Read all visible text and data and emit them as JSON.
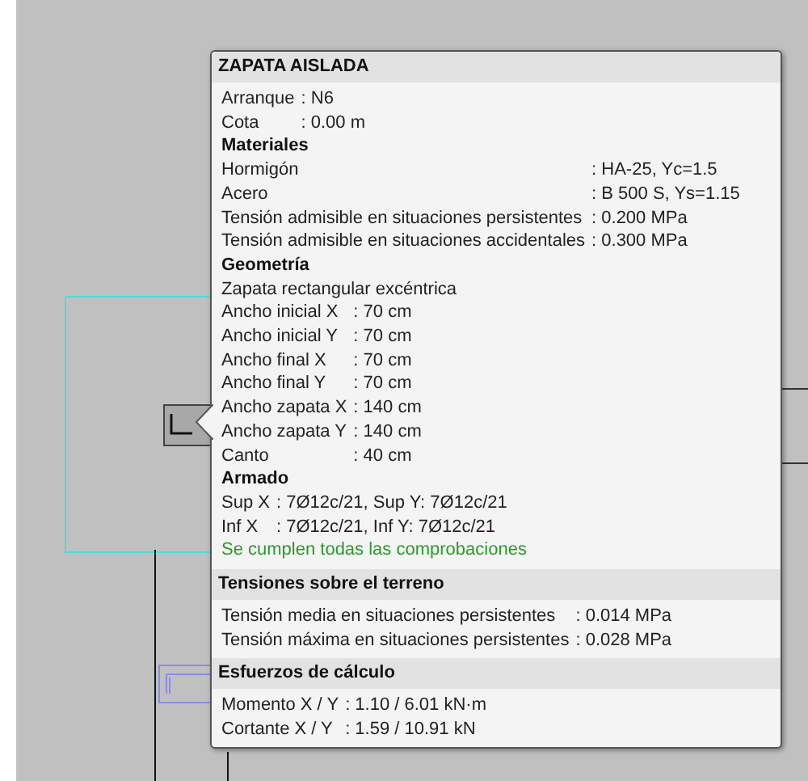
{
  "panel": {
    "sections": [
      {
        "title": "ZAPATA AISLADA",
        "blocks": [
          {
            "kind": "pairs",
            "rows": [
              {
                "label": "Arranque",
                "value": ": N6"
              },
              {
                "label": "Cota",
                "value": ": 0.00 m"
              }
            ]
          },
          {
            "kind": "heading",
            "text": "Materiales"
          },
          {
            "kind": "pairs",
            "rows": [
              {
                "label": "Hormigón",
                "value": ": HA-25, Yc=1.5"
              },
              {
                "label": "Acero",
                "value": ": B 500 S, Ys=1.15"
              },
              {
                "label": "Tensión admisible en situaciones persistentes",
                "value": ": 0.200 MPa"
              },
              {
                "label": "Tensión admisible en situaciones accidentales",
                "value": ": 0.300 MPa"
              }
            ]
          },
          {
            "kind": "heading",
            "text": "Geometría"
          },
          {
            "kind": "line",
            "text": "Zapata rectangular excéntrica"
          },
          {
            "kind": "pairs",
            "rows": [
              {
                "label": "Ancho inicial X",
                "value": ": 70 cm"
              },
              {
                "label": "Ancho inicial Y",
                "value": ": 70 cm"
              },
              {
                "label": "Ancho final X",
                "value": ": 70 cm"
              },
              {
                "label": "Ancho final Y",
                "value": ": 70 cm"
              },
              {
                "label": "Ancho zapata X",
                "value": ": 140 cm"
              },
              {
                "label": "Ancho zapata Y",
                "value": ": 140 cm"
              },
              {
                "label": "Canto",
                "value": ": 40 cm"
              }
            ]
          },
          {
            "kind": "heading",
            "text": "Armado"
          },
          {
            "kind": "pairs",
            "rows": [
              {
                "label": "Sup X",
                "value": ": 7Ø12c/21, Sup Y: 7Ø12c/21"
              },
              {
                "label": "Inf X",
                "value": ": 7Ø12c/21, Inf Y: 7Ø12c/21"
              }
            ]
          },
          {
            "kind": "status",
            "text": "Se cumplen todas las comprobaciones"
          }
        ]
      },
      {
        "title": "Tensiones sobre el terreno",
        "blocks": [
          {
            "kind": "pairs",
            "rows": [
              {
                "label": "Tensión media en situaciones persistentes",
                "value": ": 0.014 MPa"
              },
              {
                "label": "Tensión máxima en situaciones persistentes",
                "value": ": 0.028 MPa"
              }
            ]
          }
        ]
      },
      {
        "title": "Esfuerzos de cálculo",
        "blocks": [
          {
            "kind": "pairs",
            "rows": [
              {
                "label": "Momento X / Y",
                "value": ": 1.10 / 6.01 kN·m"
              },
              {
                "label": "Cortante X / Y",
                "value": ": 1.59 / 10.91 kN"
              }
            ]
          }
        ]
      }
    ]
  }
}
